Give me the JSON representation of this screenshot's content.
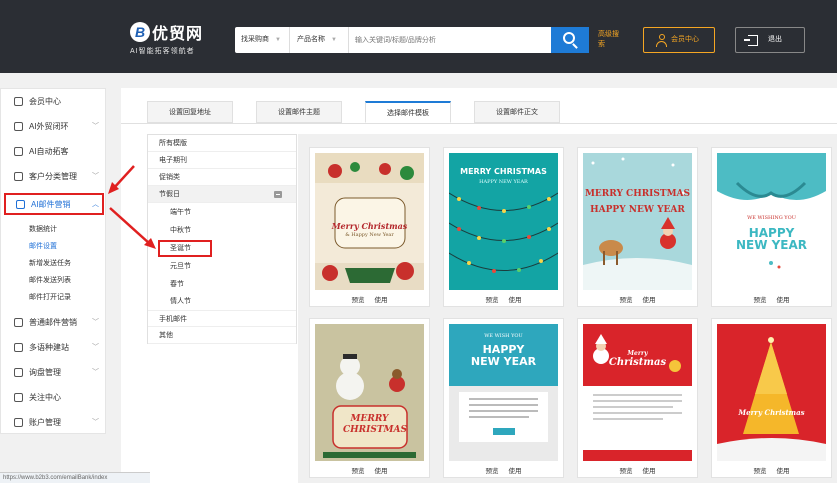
{
  "header": {
    "logo_mark": "B",
    "brand": "优贸网",
    "slogan": "AI智能拓客领航者",
    "search": {
      "type_select": "找采购商",
      "field_select": "产品名称",
      "placeholder": "输入关键词/标题/品牌分析"
    },
    "advanced_search": "高级搜索",
    "member_center": "会员中心",
    "logout": "退出"
  },
  "sidebar": {
    "items": [
      {
        "label": "会员中心",
        "icon": "home-icon"
      },
      {
        "label": "AI外贸闭环",
        "icon": "loop-icon",
        "chevron": "﹀"
      },
      {
        "label": "AI自动拓客",
        "icon": "ai-icon"
      },
      {
        "label": "客户分类管理",
        "icon": "people-icon",
        "chevron": "﹀"
      },
      {
        "label": "AI邮件营销",
        "icon": "mail-icon",
        "chevron": "︿"
      },
      {
        "label": "普通邮件营销",
        "icon": "mail-icon",
        "chevron": "﹀"
      },
      {
        "label": "多语种建站",
        "icon": "site-icon",
        "chevron": "﹀"
      },
      {
        "label": "询盘管理",
        "icon": "inquiry-icon",
        "chevron": "﹀"
      },
      {
        "label": "关注中心",
        "icon": "heart-icon"
      },
      {
        "label": "账户管理",
        "icon": "user-icon",
        "chevron": "﹀"
      }
    ],
    "sub_items": [
      "数据统计",
      "邮件设置",
      "新增发送任务",
      "邮件发送列表",
      "邮件打开记录"
    ]
  },
  "tabs": [
    "设置回复地址",
    "设置邮件主题",
    "选择邮件模板",
    "设置邮件正文"
  ],
  "categories": {
    "top": [
      "所有模版",
      "电子期刊",
      "促销类"
    ],
    "group": "节假日",
    "holidays": [
      "端午节",
      "中秋节",
      "圣诞节",
      "元旦节",
      "春节",
      "情人节"
    ],
    "bottom": [
      "手机邮件",
      "其他"
    ]
  },
  "templates": [
    {
      "preview": "预览",
      "use": "使用",
      "title": "Merry Christmas",
      "sub": "& Happy New Year"
    },
    {
      "preview": "预览",
      "use": "使用",
      "title": "MERRY CHRISTMAS",
      "sub": "HAPPY NEW YEAR"
    },
    {
      "preview": "预览",
      "use": "使用",
      "title": "MERRY CHRISTMAS",
      "sub": "HAPPY NEW YEAR"
    },
    {
      "preview": "预览",
      "use": "使用",
      "title": "HAPPY NEW YEAR",
      "sub": "WE WISHING YOU"
    },
    {
      "preview": "预览",
      "use": "使用",
      "title": "MERRY CHRISTMAS",
      "sub": ""
    },
    {
      "preview": "预览",
      "use": "使用",
      "title": "HAPPY NEW YEAR",
      "sub": "WE WISH YOU"
    },
    {
      "preview": "预览",
      "use": "使用",
      "title": "Christmas",
      "sub": "Merry"
    },
    {
      "preview": "预览",
      "use": "使用",
      "title": "Merry Christmas",
      "sub": ""
    }
  ],
  "status_url": "https://www.b2b3.com/emailBank/index",
  "colors": {
    "header": "#2b2e34",
    "accent": "#1e7bd6",
    "orange": "#f5a623",
    "highlight": "#e02020"
  }
}
